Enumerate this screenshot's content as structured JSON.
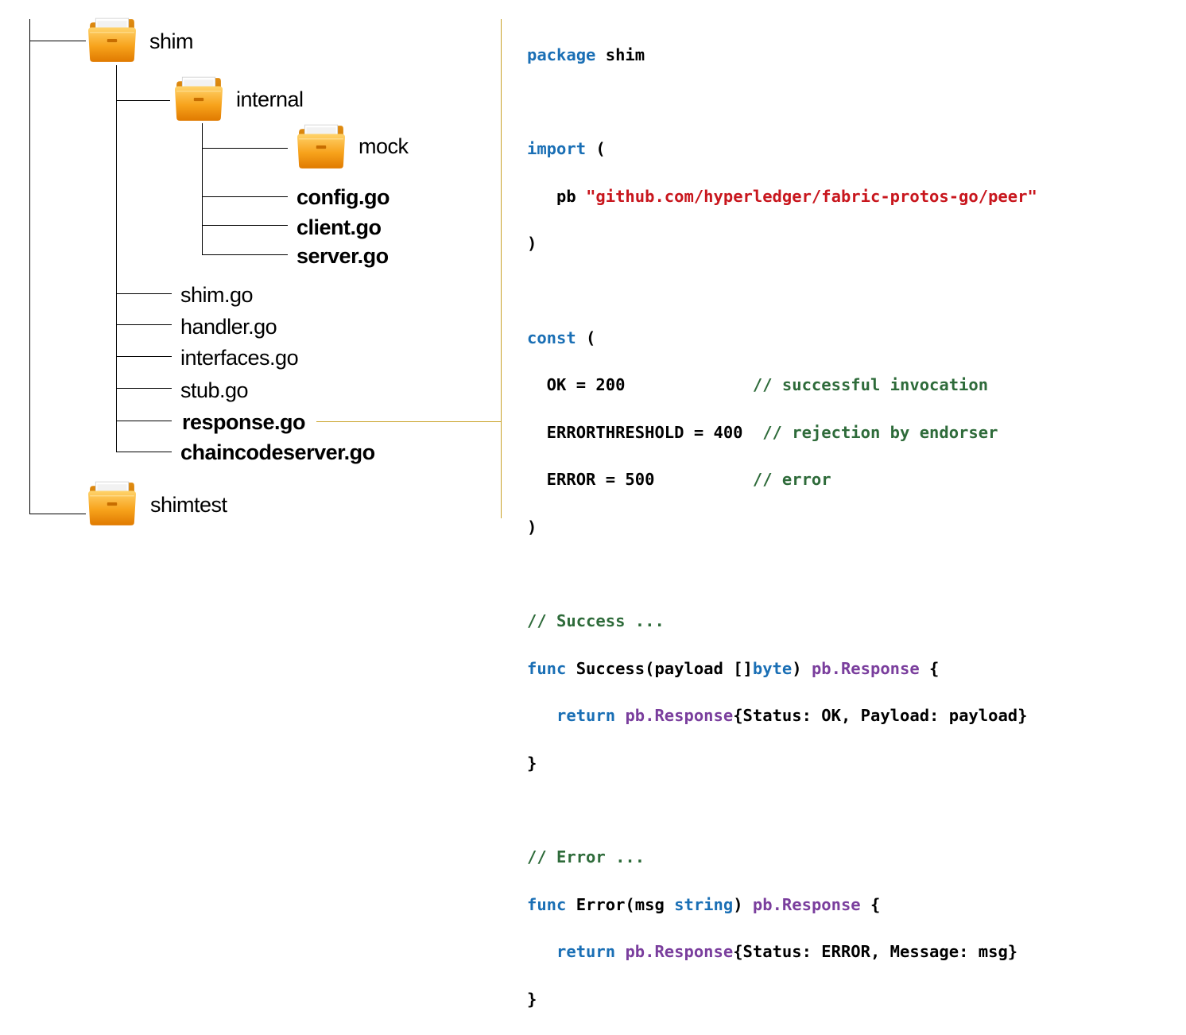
{
  "colors": {
    "keyword": "#1a6fb5",
    "string": "#c8161d",
    "comment": "#2e6b3a",
    "type": "#7a3e9d",
    "connector": "#c9a227",
    "folder": "#f5a623"
  },
  "tree": {
    "shim": "shim",
    "internal": "internal",
    "mock": "mock",
    "config": "config.go",
    "client": "client.go",
    "server": "server.go",
    "shim_go": "shim.go",
    "handler": "handler.go",
    "interfaces": "interfaces.go",
    "stub": "stub.go",
    "response": "response.go",
    "chaincodeserver": "chaincodeserver.go",
    "shimtest": "shimtest"
  },
  "code": {
    "l1_kw": "package",
    "l1_rest": " shim",
    "l2_kw": "import",
    "l2_rest": " (",
    "l3_indent": "   ",
    "l3_alias": "pb ",
    "l3_str": "\"github.com/hyperledger/fabric-protos-go/peer\"",
    "l4": ")",
    "l5_kw": "const",
    "l5_rest": " (",
    "l6_code": "  OK = 200             ",
    "l6_cm": "// successful invocation",
    "l7_code": "  ERRORTHRESHOLD = 400  ",
    "l7_cm": "// rejection by endorser",
    "l8_code": "  ERROR = 500          ",
    "l8_cm": "// error",
    "l9": ")",
    "l10_cm": "// Success ...",
    "l11_kw": "func",
    "l11_a": " Success(payload []",
    "l11_kw2": "byte",
    "l11_b": ") ",
    "l11_ty": "pb.Response",
    "l11_c": " {",
    "l12_indent": "   ",
    "l12_kw": "return",
    "l12_sp": " ",
    "l12_ty": "pb.Response",
    "l12_rest": "{Status: OK, Payload: payload}",
    "l13": "}",
    "l14_cm": "// Error ...",
    "l15_kw": "func",
    "l15_a": " Error(msg ",
    "l15_kw2": "string",
    "l15_b": ") ",
    "l15_ty": "pb.Response",
    "l15_c": " {",
    "l16_indent": "   ",
    "l16_kw": "return",
    "l16_sp": " ",
    "l16_ty": "pb.Response",
    "l16_rest": "{Status: ERROR, Message: msg}",
    "l17": "}"
  }
}
